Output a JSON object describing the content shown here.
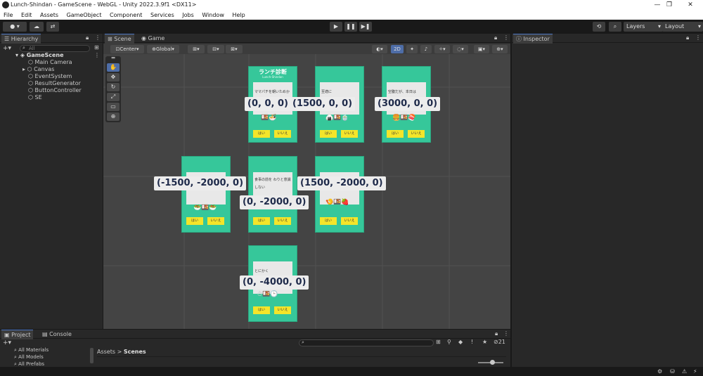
{
  "window": {
    "title": "Lunch-Shindan - GameScene - WebGL - Unity 2022.3.9f1 <DX11>"
  },
  "menu": [
    "File",
    "Edit",
    "Assets",
    "GameObject",
    "Component",
    "Services",
    "Jobs",
    "Window",
    "Help"
  ],
  "toolbar": {
    "layers_label": "Layers",
    "layout_label": "Layout"
  },
  "hierarchy": {
    "tab_label": "Hierarchy",
    "search_placeholder": "All",
    "scene_name": "GameScene",
    "items": [
      "Main Camera",
      "Canvas",
      "EventSystem",
      "ResultGenerator",
      "ButtonController",
      "SE"
    ]
  },
  "scene": {
    "tab_scene": "Scene",
    "tab_game": "Game",
    "pivot_label": "Center",
    "space_label": "Global",
    "mode_2d": "2D"
  },
  "cards": [
    {
      "label": "(0, 0, 0)",
      "title": "ランチ診断",
      "subtitle": "Lunch-Shindan",
      "text": "ママパチを朝いためか",
      "yes": "はい",
      "no": "いいえ"
    },
    {
      "label": "(1500, 0, 0)",
      "title": "",
      "subtitle": "",
      "text": "至適に",
      "yes": "はい",
      "no": "いいえ"
    },
    {
      "label": "(3000, 0, 0)",
      "title": "",
      "subtitle": "",
      "text": "空腹だが、本日は",
      "yes": "はい",
      "no": "いいえ"
    },
    {
      "label": "(-1500, -2000, 0)",
      "title": "",
      "subtitle": "",
      "text": "",
      "yes": "はい",
      "no": "いいえ"
    },
    {
      "label": "(0, -2000, 0)",
      "title": "",
      "subtitle": "",
      "text": "食事の前を わりと意識しない",
      "yes": "はい",
      "no": "いいえ"
    },
    {
      "label": "(1500, -2000, 0)",
      "title": "",
      "subtitle": "",
      "text": "",
      "yes": "はい",
      "no": "いいえ"
    },
    {
      "label": "(0, -4000, 0)",
      "title": "",
      "subtitle": "",
      "text": "とにかく",
      "yes": "はい",
      "no": "いいえ"
    }
  ],
  "inspector": {
    "tab_label": "Inspector"
  },
  "project": {
    "tab_project": "Project",
    "tab_console": "Console",
    "favorites": [
      "All Materials",
      "All Models",
      "All Prefabs"
    ],
    "breadcrumb_root": "Assets",
    "breadcrumb_sep": ">",
    "breadcrumb_current": "Scenes",
    "hidden_count": "21"
  }
}
